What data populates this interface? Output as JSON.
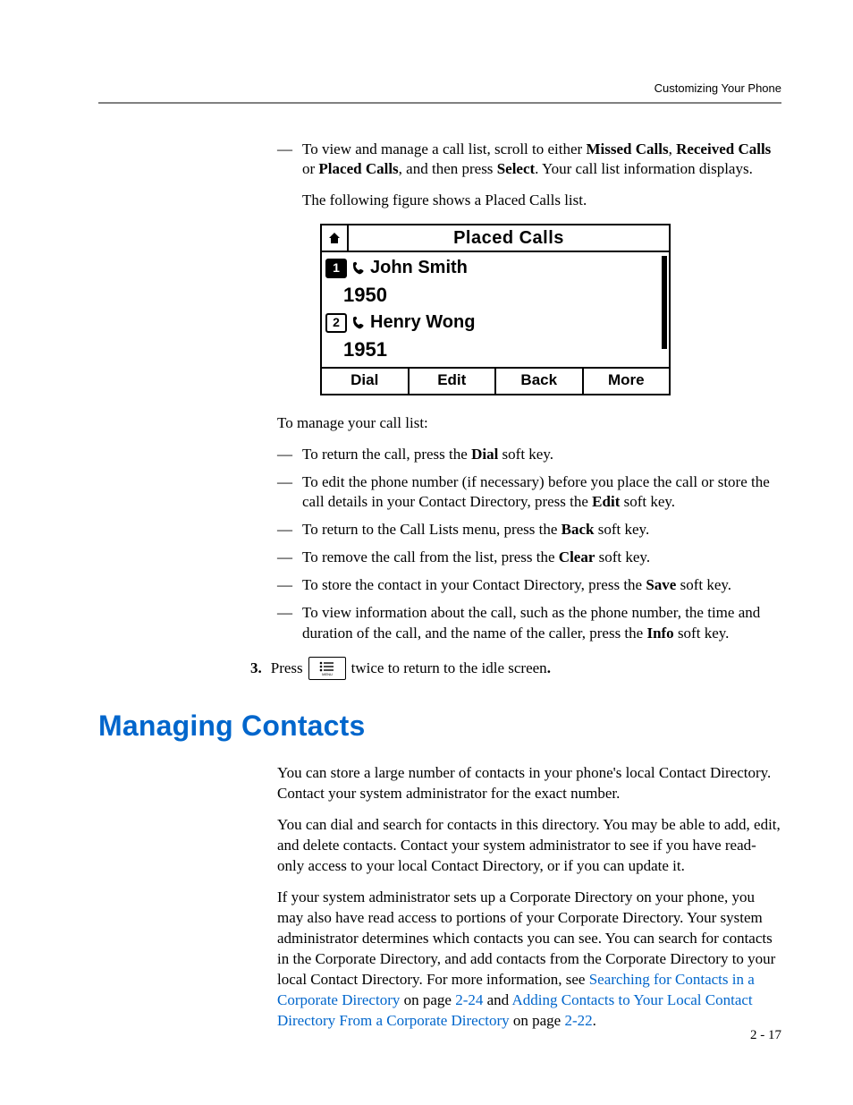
{
  "running_head": "Customizing Your Phone",
  "intro_bullet": {
    "pre": "To view and manage a call list, scroll to either ",
    "b1": "Missed Calls",
    "mid1": ", ",
    "b2": "Received Calls",
    "mid2": " or ",
    "b3": "Placed Calls",
    "mid3": ", and then press ",
    "b4": "Select",
    "post": ". Your call list information displays."
  },
  "fig_caption": "The following figure shows a Placed Calls list.",
  "phone": {
    "title": "Placed Calls",
    "row1_name": "John Smith",
    "row1_num": "1950",
    "row2_name": "Henry Wong",
    "row2_num": "1951",
    "sk1": "Dial",
    "sk2": "Edit",
    "sk3": "Back",
    "sk4": "More",
    "idx1": "1",
    "idx2": "2"
  },
  "manage_intro": "To manage your call list:",
  "bullets": {
    "b1_pre": "To return the call, press the ",
    "b1_key": "Dial",
    "b1_post": " soft key.",
    "b2_pre": "To edit the phone number (if necessary) before you place the call or store the call details in your Contact Directory, press the ",
    "b2_key": "Edit",
    "b2_post": " soft key.",
    "b3_pre": "To return to the Call Lists menu, press the ",
    "b3_key": "Back",
    "b3_post": " soft key.",
    "b4_pre": "To remove the call from the list, press the ",
    "b4_key": "Clear",
    "b4_post": " soft key.",
    "b5_pre": "To store the contact in your Contact Directory, press the ",
    "b5_key": "Save",
    "b5_post": " soft key.",
    "b6_pre": "To view information about the call, such as the phone number, the time and duration of the call, and the name of the caller, press the ",
    "b6_key": "Info",
    "b6_post": " soft key."
  },
  "step3": {
    "num": "3.",
    "pre": "Press",
    "post_pre": "twice to return to the idle screen",
    "period": "."
  },
  "section_title": "Managing Contacts",
  "mc": {
    "p1": "You can store a large number of contacts in your phone's local Contact Directory. Contact your system administrator for the exact number.",
    "p2": "You can dial and search for contacts in this directory. You may be able to add, edit, and delete contacts. Contact your system administrator to see if you have read-only access to your local Contact Directory, or if you can update it.",
    "p3_pre": "If your system administrator sets up a Corporate Directory on your phone, you may also have read access to portions of your Corporate Directory. Your system administrator determines which contacts you can see. You can search for contacts in the Corporate Directory, and add contacts from the Corporate Directory to your local Contact Directory. For more information, see ",
    "p3_link1": "Searching for Contacts in a Corporate Directory",
    "p3_mid1": " on page ",
    "p3_pg1": "2-24",
    "p3_mid2": " and ",
    "p3_link2": "Adding Contacts to Your Local Contact Directory From a Corporate Directory",
    "p3_mid3": " on page ",
    "p3_pg2": "2-22",
    "p3_post": "."
  },
  "page_num": "2 - 17"
}
